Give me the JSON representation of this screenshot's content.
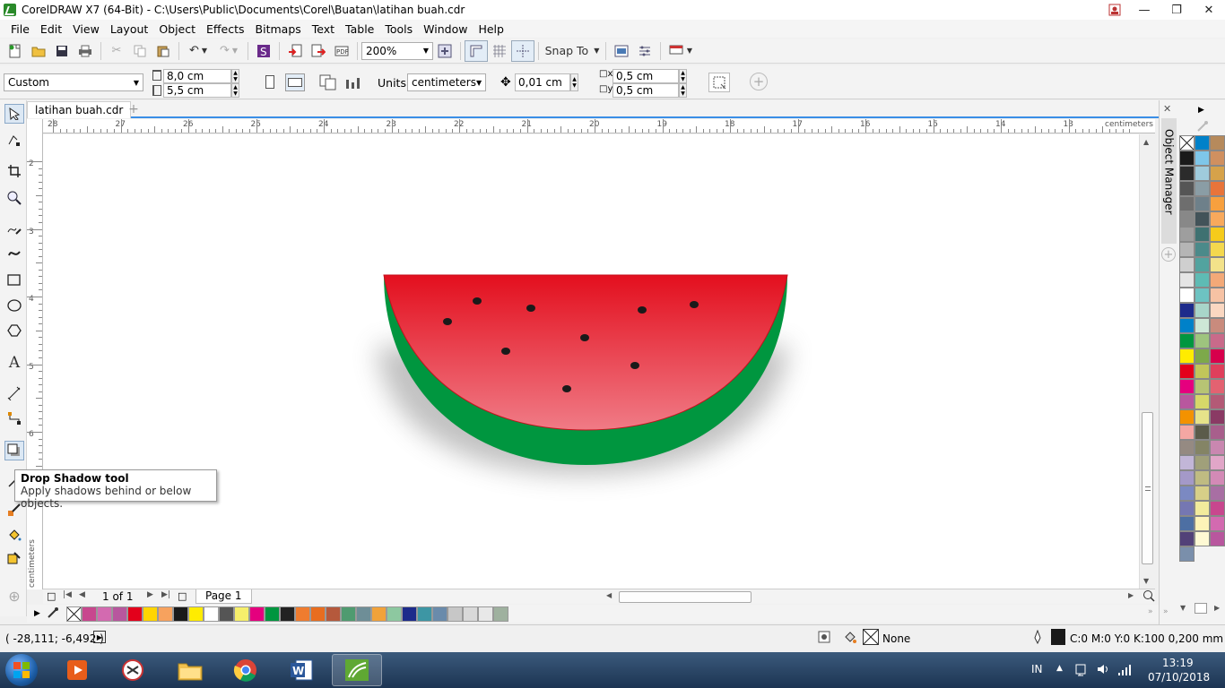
{
  "window": {
    "title": "CorelDRAW X7 (64-Bit) - C:\\Users\\Public\\Documents\\Corel\\Buatan\\latihan buah.cdr"
  },
  "menu": [
    "File",
    "Edit",
    "View",
    "Layout",
    "Object",
    "Effects",
    "Bitmaps",
    "Text",
    "Table",
    "Tools",
    "Window",
    "Help"
  ],
  "toolbar": {
    "zoom": "200%",
    "snap_to": "Snap To"
  },
  "propertybar": {
    "preset": "Custom",
    "width": "8,0 cm",
    "height": "5,5 cm",
    "units_label": "Units:",
    "units": "centimeters",
    "nudge": "0,01 cm",
    "dup_x": "0,5 cm",
    "dup_y": "0,5 cm"
  },
  "document": {
    "tab": "latihan buah.cdr"
  },
  "ruler": {
    "h_ticks": [
      "28",
      "27",
      "26",
      "25",
      "24",
      "23",
      "22",
      "21",
      "20",
      "19",
      "18",
      "17",
      "16",
      "15",
      "14",
      "13"
    ],
    "h_unit": "centimeters",
    "v_ticks": [
      "2",
      "3",
      "4",
      "5",
      "6"
    ],
    "v_unit": "centimeters"
  },
  "tooltip": {
    "title": "Drop Shadow tool",
    "desc": "Apply shadows behind or below objects."
  },
  "pager": {
    "count": "1 of 1",
    "page_tab": "Page 1"
  },
  "docker": {
    "object_manager": "Object Manager"
  },
  "status": {
    "coords": "( -28,111; -6,492 )",
    "fill": "None",
    "outline": "C:0 M:0 Y:0 K:100  0,200 mm"
  },
  "taskbar": {
    "lang": "IN",
    "time": "13:19",
    "date": "07/10/2018"
  },
  "colors": {
    "rind": "#00963f",
    "flesh_top": "#e30f1e",
    "flesh_bottom": "#f07b86",
    "seed": "#1a1a1a",
    "accent": "#3a8ee6"
  },
  "doc_palette": [
    "#c8478e",
    "#d36ab0",
    "#b8579e",
    "#e3001b",
    "#ffd500",
    "#f7a25e",
    "#1a1a1a",
    "#ffec00",
    "#ffffff",
    "#555555",
    "#f6ef6b",
    "#e5007e",
    "#00963f",
    "#222222",
    "#ef7c2f",
    "#e86d1f",
    "#b5593c",
    "#4f9b70",
    "#6e8e97",
    "#f1a23a",
    "#8dc8a0",
    "#1d2b8b",
    "#3d96a4",
    "#6a8bab",
    "#c7c7c7",
    "#d9d9d9",
    "#e8e8e8",
    "#9fb19f"
  ],
  "color_palette": [
    [
      "#1a1a1a",
      "#2b2b2b",
      "#555555",
      "#6e6e6e",
      "#888888",
      "#9e9e9e",
      "#b5b5b5",
      "#cfcfcf",
      "#e5e5e5",
      "#ffffff",
      "#1d2b8b",
      "#0081c9",
      "#00963f",
      "#ffec00",
      "#e3001b",
      "#e5007e",
      "#b8579e",
      "#f39200",
      "#f4a7a3",
      "#958a82",
      "#c2b6d8",
      "#a499c8",
      "#7b89c2",
      "#7577b2",
      "#4d6fa3",
      "#524178",
      "#7a8fab"
    ],
    [
      "#0081c9",
      "#7ec6e9",
      "#9fcbdc",
      "#8a9da5",
      "#6e808a",
      "#435359",
      "#3e7171",
      "#4b8a8a",
      "#52a39f",
      "#5ebbb4",
      "#6dc3c2",
      "#a8d5c9",
      "#cde7d6",
      "#9ec47e",
      "#7da94a",
      "#c1c65a",
      "#b7c474",
      "#d6d869",
      "#e6e38a",
      "#5b5b4a",
      "#848465",
      "#a0a07a",
      "#bfbb82",
      "#d7cf88",
      "#f2eb9c",
      "#fdf3b8",
      "#fef9d4"
    ],
    [
      "#b68a5c",
      "#d09060",
      "#d6a24a",
      "#e8743a",
      "#f7a03e",
      "#f8a95c",
      "#f5cb1b",
      "#f4d84e",
      "#f3e28a",
      "#f3a978",
      "#f6c2a4",
      "#fad7c1",
      "#c98b7d",
      "#c96a8a",
      "#d7004c",
      "#df3f5c",
      "#e36271",
      "#b35a76",
      "#8a3a64",
      "#a85f8c",
      "#c987b0",
      "#e1a6c8",
      "#d38ab6",
      "#a86fa3",
      "#c8478e",
      "#d36ab0",
      "#b8579e"
    ]
  ]
}
